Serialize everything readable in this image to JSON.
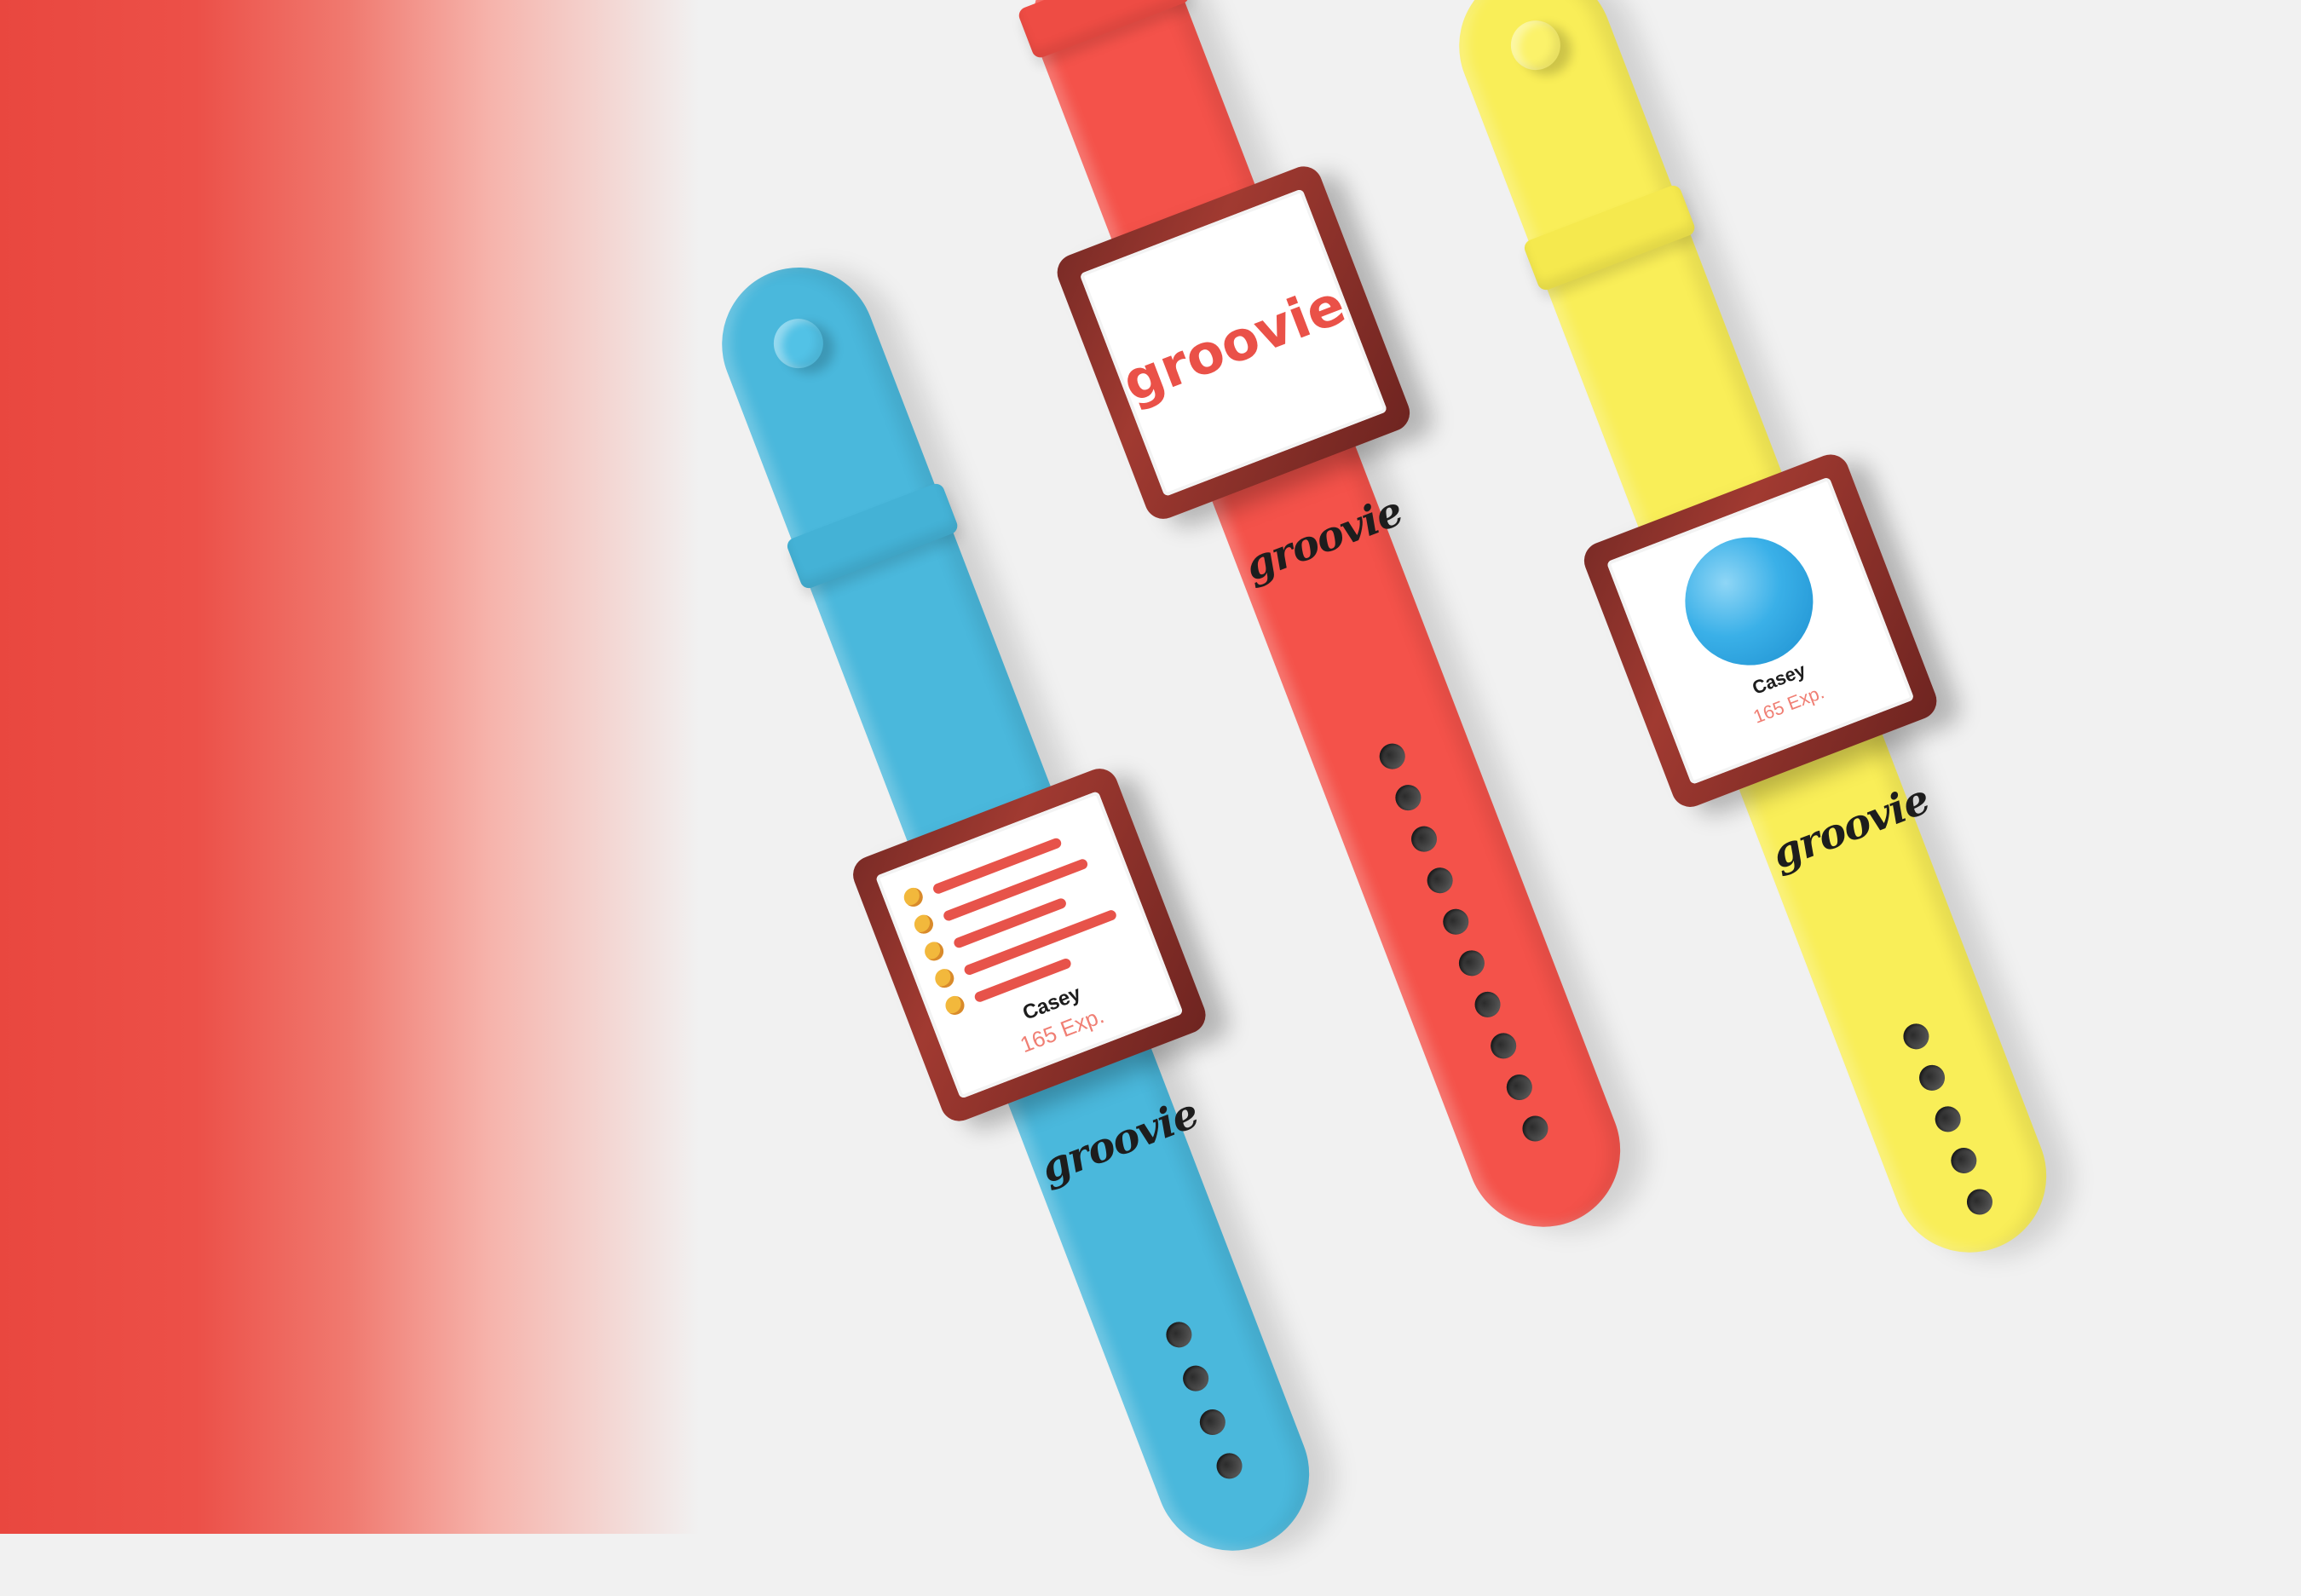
{
  "image": {
    "subject": "Groovie smartwatches",
    "background_color": "#f1f1f1",
    "accent_haze_color": "#ea4a42"
  },
  "watches": [
    {
      "strap_color": "#4ab8dc",
      "screen": {
        "type": "leaderboard",
        "name": "Casey",
        "exp": "165 Exp."
      },
      "strap_brand": "groovie"
    },
    {
      "strap_color": "#f4524a",
      "screen": {
        "type": "logo",
        "logo": "groovie"
      },
      "strap_brand": "groovie"
    },
    {
      "strap_color": "#f9ee58",
      "screen": {
        "type": "profile",
        "name": "Casey",
        "exp": "165 Exp."
      },
      "strap_brand": "groovie"
    }
  ]
}
